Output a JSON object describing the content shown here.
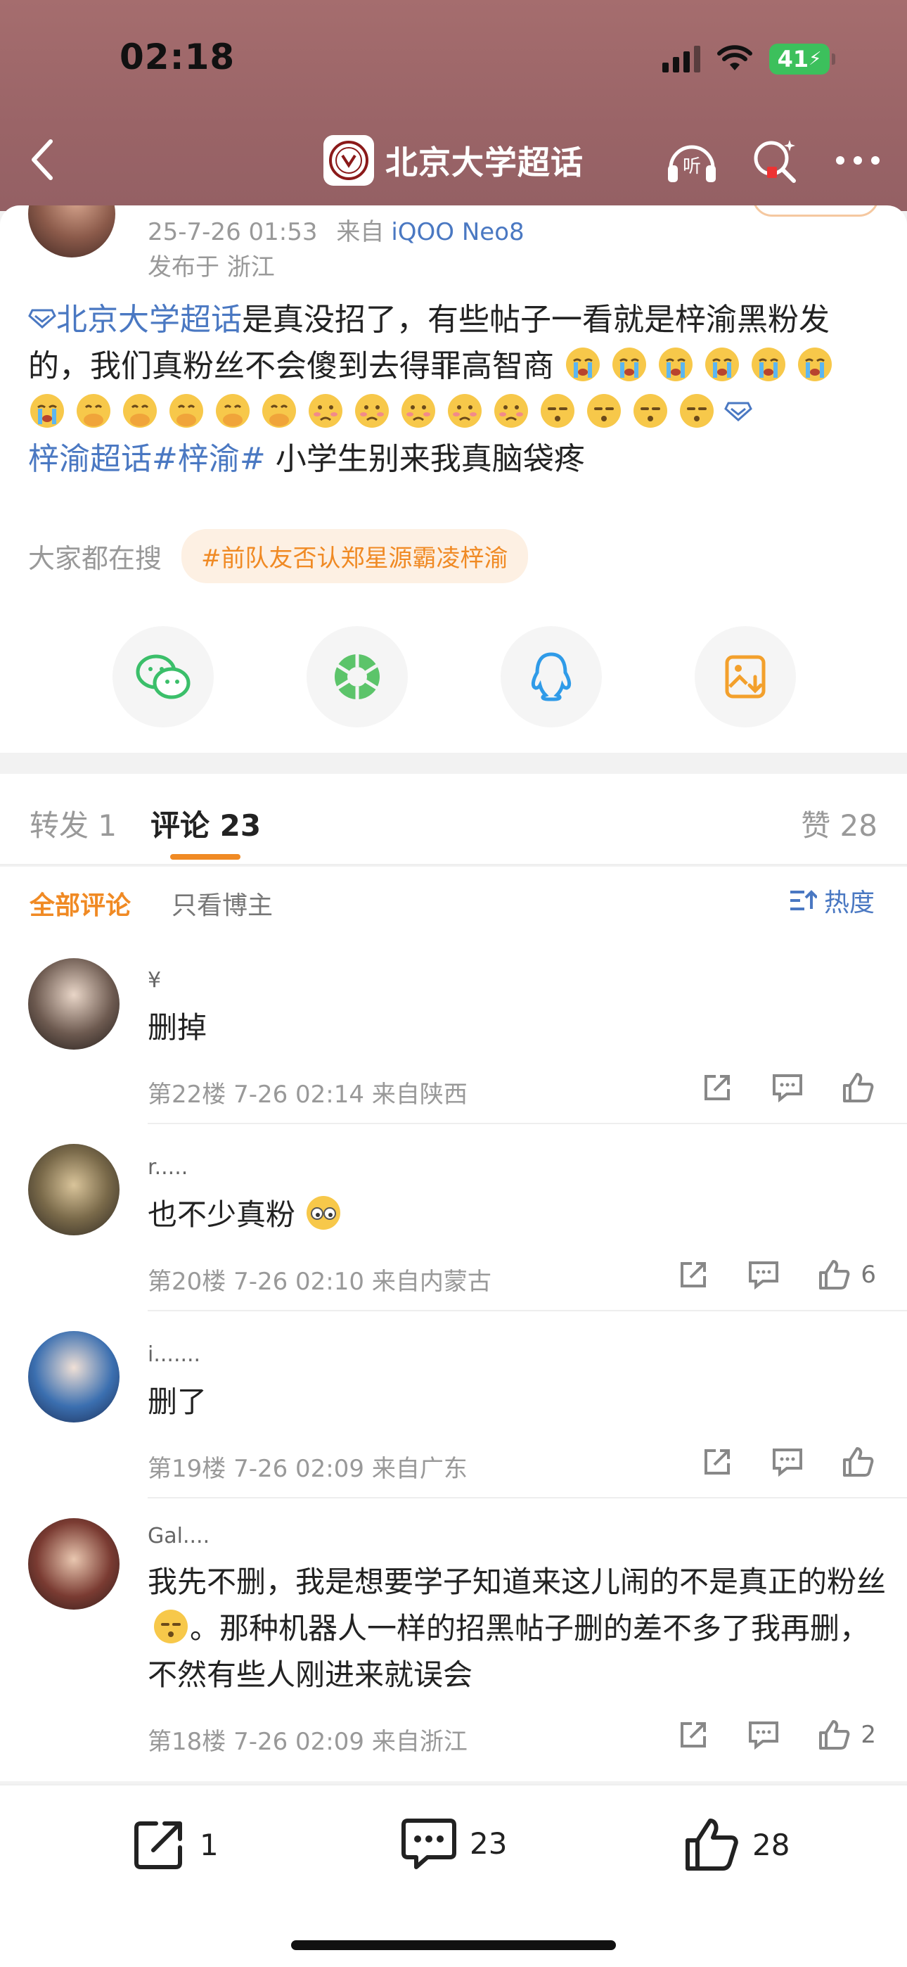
{
  "status": {
    "time": "02:18",
    "battery": "41"
  },
  "nav": {
    "title": "北京大学超话"
  },
  "post": {
    "time": "25-7-26 01:53",
    "source_prefix": "来自",
    "device": "iQOO Neo8",
    "location": "发布于 浙江",
    "topic_link": "北京大学超话",
    "text1": "是真没招了，有些帖子一看就是梓渝黑粉发的，我们真粉丝不会傻到去得罪高智商",
    "topic2": "梓渝超话",
    "hashtag": "#梓渝#",
    "text2": " 小学生别来我真脑袋疼"
  },
  "search": {
    "label": "大家都在搜",
    "chip": "#前队友否认郑星源霸凌梓渝"
  },
  "share": {
    "icons": [
      "wechat-icon",
      "moments-icon",
      "qq-icon",
      "save-image-icon"
    ]
  },
  "tabs": {
    "repost": "转发 1",
    "comment": "评论 23",
    "like": "赞 28"
  },
  "filter": {
    "all": "全部评论",
    "owner_only": "只看博主",
    "sort": "热度"
  },
  "comments": [
    {
      "name": "¥",
      "text": "删掉",
      "meta": "第22楼 7-26 02:14 来自陕西",
      "likes": ""
    },
    {
      "name": "r.....",
      "text": "也不少真粉",
      "meta": "第20楼 7-26 02:10 来自内蒙古",
      "likes": "6"
    },
    {
      "name": "ⅰ.......",
      "text": "删了",
      "meta": "第19楼 7-26 02:09 来自广东",
      "likes": ""
    },
    {
      "name": "Gal....",
      "text_a": "我先不删，我是想要学子知道来这儿闹的不是真正的粉丝",
      "text_b": "。那种机器人一样的招黑帖子删的差不多了我再删，不然有些人刚进来就误会",
      "meta": "第18楼 7-26 02:09 来自浙江",
      "likes": "2"
    }
  ],
  "bottom": {
    "repost": "1",
    "comment": "23",
    "like": "28"
  },
  "colors": {
    "accent": "#f08a24",
    "link": "#4a78c2",
    "header": "#9a6467"
  }
}
